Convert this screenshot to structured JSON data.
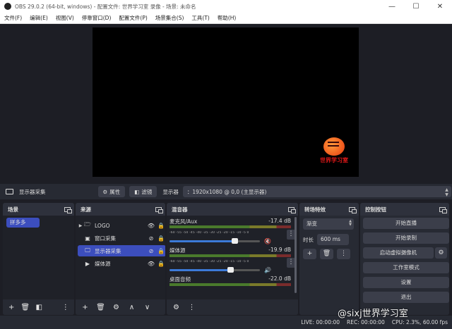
{
  "window": {
    "title": "OBS 29.0.2 (64-bit, windows) - 配置文件: 世界学习室 录像 - 场景: 未命名",
    "minimize": "—",
    "maximize": "☐",
    "close": "✕"
  },
  "menu": [
    "文件(F)",
    "编辑(E)",
    "视图(V)",
    "停靠窗口(D)",
    "配置文件(P)",
    "场景集合(S)",
    "工具(T)",
    "帮助(H)"
  ],
  "preview": {
    "watermark_text": "世界学习室"
  },
  "source_toolbar": {
    "selected_source": "显示器采集",
    "properties_label": "属性",
    "filters_label": "滤镜",
    "display_label": "显示器",
    "display_value": "：1920x1080 @ 0,0 (主显示器)"
  },
  "scenes": {
    "title": "场景",
    "items": [
      "拼多多"
    ]
  },
  "sources": {
    "title": "来源",
    "items": [
      {
        "name": "LOGO",
        "icon": "folder-icon",
        "expandable": true,
        "visible": true,
        "locked": false,
        "selected": false
      },
      {
        "name": "窗口采集",
        "icon": "window-icon",
        "expandable": false,
        "visible": false,
        "locked": false,
        "selected": false
      },
      {
        "name": "显示器采集",
        "icon": "monitor-icon",
        "expandable": false,
        "visible": false,
        "locked": false,
        "selected": true
      },
      {
        "name": "媒体源",
        "icon": "play-icon",
        "expandable": false,
        "visible": true,
        "locked": false,
        "selected": false
      }
    ]
  },
  "mixer": {
    "title": "混音器",
    "ticks": "-60  -55  -50  -45  -40  -35  -30  -25  -20  -15  -10   -5    0",
    "channels": [
      {
        "name": "麦克风/Aux",
        "db": "-17.4 dB",
        "muted": true,
        "level": 0.72
      },
      {
        "name": "媒体源",
        "db": "-19.9 dB",
        "muted": false,
        "level": 0.67
      },
      {
        "name": "桌面音频",
        "db": "-22.0 dB",
        "muted": false,
        "level": 0.6
      }
    ]
  },
  "transitions": {
    "title": "转场特效",
    "selected": "渐变",
    "duration_label": "时长",
    "duration_value": "600 ms"
  },
  "controls": {
    "title": "控制按钮",
    "start_streaming": "开始直播",
    "start_recording": "开始录制",
    "start_virtual_cam": "启动虚拟摄像机",
    "studio_mode": "工作室模式",
    "settings": "设置",
    "exit": "退出"
  },
  "status": {
    "live": "LIVE: 00:00:00",
    "rec": "REC: 00:00:00",
    "cpu": "CPU: 2.3%, 60.00 fps"
  },
  "overlay_watermark": "@sixj世界学习室",
  "colors": {
    "accent": "#3c4ebd",
    "bg": "#1d1e25",
    "panel": "#272a33"
  }
}
